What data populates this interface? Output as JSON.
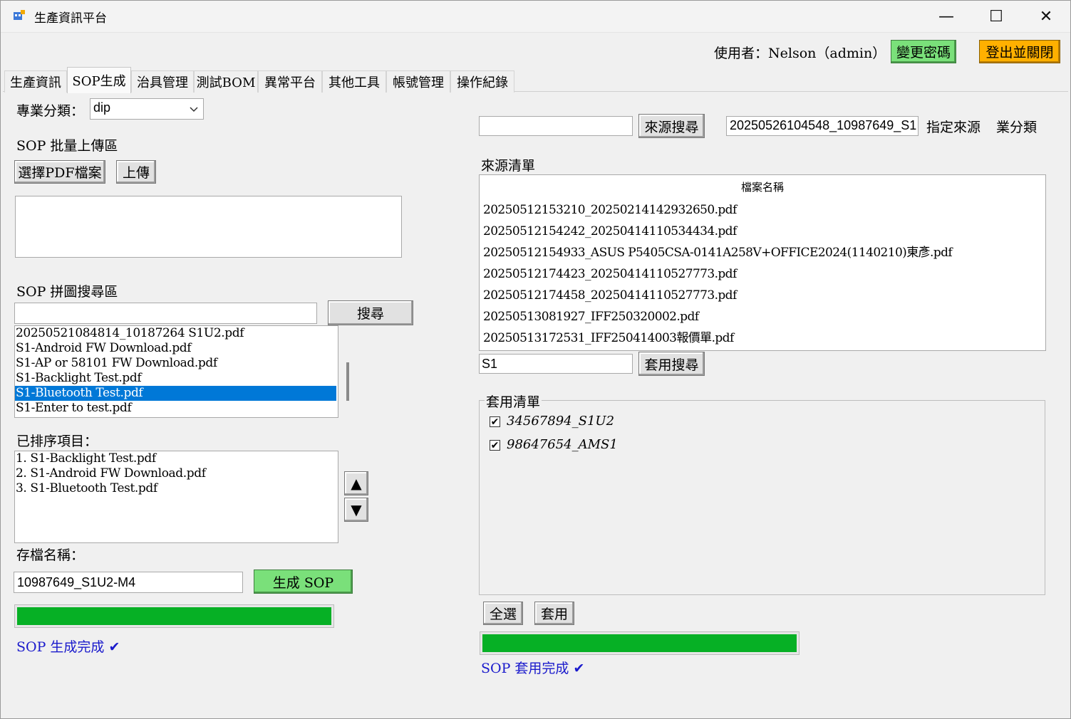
{
  "window": {
    "title": "生產資訊平台",
    "minimize_glyph": "—",
    "maximize_glyph": "☐",
    "close_glyph": "✕"
  },
  "header": {
    "user_label": "使用者：Nelson（admin）",
    "change_password_label": "變更密碼",
    "logout_label": "登出並關閉"
  },
  "tabs": [
    {
      "label": "生產資訊",
      "active": false
    },
    {
      "label": "SOP生成",
      "active": true
    },
    {
      "label": "治具管理",
      "active": false
    },
    {
      "label": "測試BOM",
      "active": false
    },
    {
      "label": "異常平台",
      "active": false
    },
    {
      "label": "其他工具",
      "active": false
    },
    {
      "label": "帳號管理",
      "active": false
    },
    {
      "label": "操作紀錄",
      "active": false
    }
  ],
  "left": {
    "category_label": "專業分類：",
    "category_value": "dip",
    "batch_upload_title": "SOP 批量上傳區",
    "select_pdf_label": "選擇PDF檔案",
    "upload_label": "上傳",
    "puzzle_search_title": "SOP 拼圖搜尋區",
    "search_button_label": "搜尋",
    "search_input_value": "",
    "search_results": [
      {
        "text": "20250521084814_10187264 S1U2.pdf",
        "selected": false
      },
      {
        "text": "S1-Android FW Download.pdf",
        "selected": false
      },
      {
        "text": "S1-AP or 58101 FW Download.pdf",
        "selected": false
      },
      {
        "text": "S1-Backlight Test.pdf",
        "selected": false
      },
      {
        "text": "S1-Bluetooth Test.pdf",
        "selected": true
      },
      {
        "text": "S1-Enter to test.pdf",
        "selected": false
      }
    ],
    "sorted_title": "已排序項目：",
    "sorted_items": [
      "1. S1-Backlight Test.pdf",
      "2. S1-Android FW Download.pdf",
      "3. S1-Bluetooth Test.pdf"
    ],
    "move_up_glyph": "▲",
    "move_down_glyph": "▼",
    "save_name_label": "存檔名稱：",
    "save_name_value": "10987649_S1U2-M4",
    "generate_label": "生成 SOP",
    "progress_percent": 100,
    "status_text": "SOP 生成完成 ✔"
  },
  "right": {
    "source_search_value": "",
    "source_search_label": "來源搜尋",
    "source_selected_value": "20250526104548_10987649_S1",
    "assign_source_label": "指定來源",
    "category_label": "業分類",
    "source_list_title": "來源清單",
    "source_list_header": "檔案名稱",
    "source_files": [
      "20250512153210_20250214142932650.pdf",
      "20250512154242_20250414110534434.pdf",
      "20250512154933_ASUS P5405CSA-0141A258V+OFFICE2024(1140210)東彥.pdf",
      "20250512174423_20250414110527773.pdf",
      "20250512174458_20250414110527773.pdf",
      "20250513081927_IFF250320002.pdf",
      "20250513172531_IFF250414003報價單.pdf"
    ],
    "apply_search_value": "S1",
    "apply_search_label": "套用搜尋",
    "apply_list_title": "套用清單",
    "apply_items": [
      {
        "label": "34567894_S1U2",
        "checked": true
      },
      {
        "label": "98647654_AMS1",
        "checked": true
      }
    ],
    "check_glyph": "✔",
    "select_all_label": "全選",
    "apply_label": "套用",
    "progress_percent": 100,
    "status_text": "SOP 套用完成 ✔"
  },
  "colors": {
    "progress_green": "#06b025",
    "selection_blue": "#0078d7",
    "status_blue": "#1a1acc",
    "generate_button_green": "#7ae07a",
    "logout_button_orange": "#ffb000"
  }
}
